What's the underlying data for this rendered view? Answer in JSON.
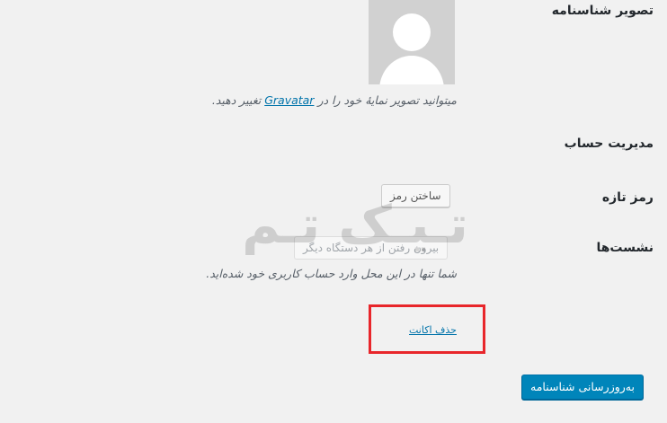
{
  "profile_picture": {
    "label": "تصویر شناسنامه",
    "description_before": "میتوانید تصویر نمایهٔ خود را در",
    "gravatar_link": "Gravatar",
    "description_after": "تغییر دهید."
  },
  "account_management": {
    "heading": "مدیریت حساب"
  },
  "new_password": {
    "label": "رمز تازه",
    "button": "ساختن رمز"
  },
  "sessions": {
    "label": "نشست‌ها",
    "button": "بیرون رفتن از هر دستگاه دیگر",
    "description": "شما تنها در این محل وارد حساب کاربری خود شده‌اید."
  },
  "delete_account": {
    "link": "حذف اکانت"
  },
  "watermark": {
    "text": "تـیـک تـم"
  },
  "update_profile": {
    "button": "به‌روزرسانی شناسنامه"
  },
  "colors": {
    "primary": "#0085ba",
    "link": "#0073aa",
    "highlight": "#e8262b",
    "background": "#f1f1f1"
  }
}
